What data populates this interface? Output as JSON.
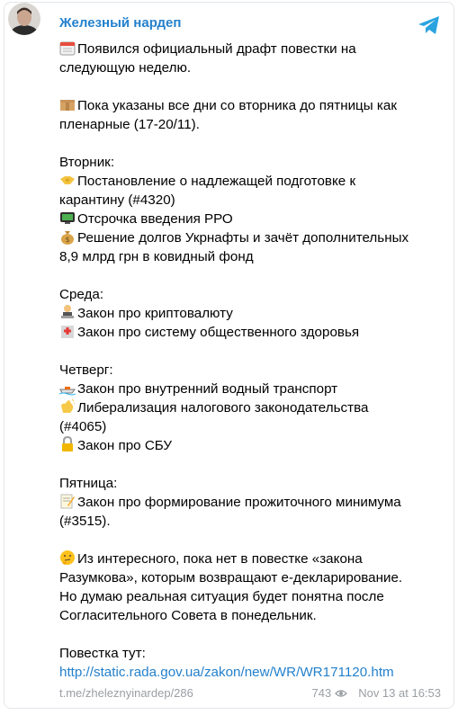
{
  "header": {
    "channel_name": "Железный нардеп"
  },
  "post": {
    "p1": [
      "Появился официальный драфт повестки на",
      "следующую неделю."
    ],
    "p2": [
      "Пока указаны все дни со вторника до пятницы как",
      "пленарные (17-20/11)."
    ],
    "tuesday": {
      "title": "Вторник:",
      "items": [
        "Постановление о надлежащей подготовке к",
        "карантину (#4320)",
        "Отсрочка введения РРО",
        "Решение долгов Укрнафты и зачёт дополнительных",
        "8,9 млрд грн в ковидный фонд"
      ]
    },
    "wednesday": {
      "title": "Среда:",
      "items": [
        "Закон про криптовалюту",
        "Закон про систему общественного здоровья"
      ]
    },
    "thursday": {
      "title": "Четверг:",
      "items": [
        "Закон про внутренний водный транспорт",
        "Либерализация налогового законодательства",
        "(#4065)",
        "Закон про СБУ"
      ]
    },
    "friday": {
      "title": "Пятница:",
      "items": [
        "Закон про формирование прожиточного минимума",
        "(#3515)."
      ]
    },
    "p3": [
      "Из интересного, пока нет в повестке «закона",
      "Разумкова», которым возвращают е-декларирование.",
      "Но думаю реальная ситуация будет понятна после",
      "Согласительного Совета в понедельник."
    ],
    "agenda_label": "Повестка тут:",
    "agenda_url": "http://static.rada.gov.ua/zakon/new/WR/WR171120.htm"
  },
  "footer": {
    "permalink": "t.me/zheleznyinardep/286",
    "views": "743",
    "date": "Nov 13 at 16:53"
  },
  "colors": {
    "link": "#2481cc",
    "muted": "#9a9ea3",
    "telegram_blue": "#2aa3df"
  }
}
